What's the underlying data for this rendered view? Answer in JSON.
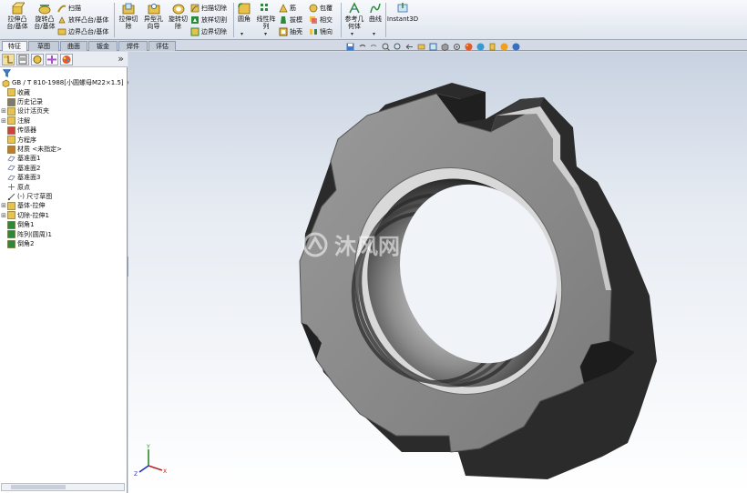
{
  "ribbon": {
    "extrude_boss": "拉伸凸\n台/基体",
    "revolve_boss": "旋转凸\n台/基体",
    "sweep": "扫描",
    "loft_boss": "放样凸台/基体",
    "boundary_boss": "边界凸台/基体",
    "extrude_cut": "拉伸切\n除",
    "hole_wizard": "异型孔\n向导",
    "revolve_cut": "旋转切\n除",
    "sweep_cut": "扫描切除",
    "loft_cut": "放样切割",
    "boundary_cut": "边界切除",
    "fillet": "圆角",
    "linear_pattern": "线性阵\n列",
    "rib": "筋",
    "draft": "拔模",
    "shell": "抽壳",
    "wrap": "包覆",
    "intersect": "相交",
    "mirror": "镜向",
    "reference_geometry": "参考几\n何体",
    "curves": "曲线",
    "instant3d": "Instant3D"
  },
  "tabs": [
    "特征",
    "草图",
    "曲面",
    "钣金",
    "焊件",
    "评估"
  ],
  "tree": {
    "part_name": "GB / T 810-1988[小圆螺母M22×1.5]（",
    "items": [
      {
        "label": "收藏",
        "plus": false,
        "icon": "folder-icon"
      },
      {
        "label": "历史记录",
        "plus": false,
        "icon": "history-icon"
      },
      {
        "label": "设计活页夹",
        "plus": true,
        "icon": "binder-icon"
      },
      {
        "label": "注解",
        "plus": true,
        "icon": "annotation-icon"
      },
      {
        "label": "传感器",
        "plus": false,
        "icon": "sensor-icon"
      },
      {
        "label": "方程序",
        "plus": false,
        "icon": "equation-icon"
      },
      {
        "label": "材质 <未指定>",
        "plus": false,
        "icon": "material-icon"
      },
      {
        "label": "基准面1",
        "plus": false,
        "icon": "plane-icon"
      },
      {
        "label": "基准面2",
        "plus": false,
        "icon": "plane-icon"
      },
      {
        "label": "基准面3",
        "plus": false,
        "icon": "plane-icon"
      },
      {
        "label": "原点",
        "plus": false,
        "icon": "origin-icon"
      },
      {
        "label": "(-) 尺寸草图",
        "plus": false,
        "icon": "sketch-icon"
      },
      {
        "label": "基体-拉伸",
        "plus": true,
        "icon": "extrude-icon"
      },
      {
        "label": "切除-拉伸1",
        "plus": true,
        "icon": "cut-extrude-icon"
      },
      {
        "label": "倒角1",
        "plus": false,
        "icon": "chamfer-icon"
      },
      {
        "label": "阵列(圆周)1",
        "plus": false,
        "icon": "circular-pattern-icon"
      },
      {
        "label": "倒角2",
        "plus": false,
        "icon": "chamfer-icon"
      }
    ]
  },
  "watermark": "沐风网",
  "panel_collapse": "»",
  "axis_labels": {
    "x": "X",
    "y": "Y",
    "z": "Z"
  },
  "colors": {
    "part_face": "#8a8a8a",
    "viewport_top": "#c8d2e1",
    "selection_line": "#c02020"
  }
}
